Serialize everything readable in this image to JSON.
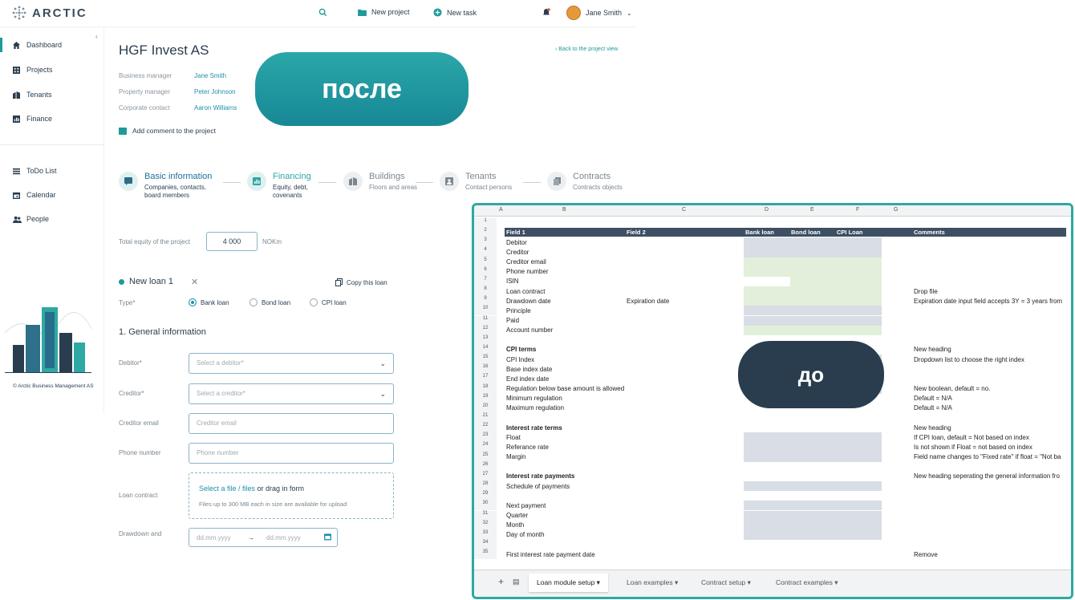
{
  "topbar": {
    "logo": "ARCTIC",
    "new_project": "New project",
    "new_task": "New task",
    "user": "Jane Smith"
  },
  "sidebar": {
    "items": [
      {
        "label": "Dashboard"
      },
      {
        "label": "Projects"
      },
      {
        "label": "Tenants"
      },
      {
        "label": "Finance"
      },
      {
        "label": "ToDo List"
      },
      {
        "label": "Calendar"
      },
      {
        "label": "People"
      }
    ],
    "company": "Arctic Business Management AS"
  },
  "project": {
    "title": "HGF Invest AS",
    "back": "Back to the project view",
    "business_manager_label": "Business manager",
    "business_manager": "Jane Smith",
    "property_manager_label": "Property manager",
    "property_manager": "Peter Johnson",
    "corporate_contact_label": "Corporate contact",
    "corporate_contact": "Aaron Williams",
    "add_comment": "Add comment to the project"
  },
  "steps": [
    {
      "title": "Basic information",
      "sub1": "Companies, contacts,",
      "sub2": "board members"
    },
    {
      "title": "Financing",
      "sub1": "Equity, debt,",
      "sub2": "covenants"
    },
    {
      "title": "Buildings",
      "sub1": "Floors and areas",
      "sub2": ""
    },
    {
      "title": "Tenants",
      "sub1": "Contact persons",
      "sub2": ""
    },
    {
      "title": "Contracts",
      "sub1": "Contracts objects",
      "sub2": ""
    }
  ],
  "equity": {
    "label": "Total equity of the project",
    "value": "4 000",
    "unit": "NOKm"
  },
  "loan": {
    "title": "New loan 1",
    "copy": "Copy this loan",
    "type_label": "Type*",
    "types": [
      "Bank loan",
      "Bond loan",
      "CPI loan"
    ],
    "section": "1. General information",
    "debitor_label": "Debitor*",
    "debitor_ph": "Select a debitor*",
    "creditor_label": "Creditor*",
    "creditor_ph": "Select a creditor*",
    "email_label": "Creditor email",
    "email_ph": "Creditor email",
    "phone_label": "Phone number",
    "phone_ph": "Phone number",
    "contract_label": "Loan contract",
    "upload_link": "Select a file / files",
    "upload_rest": " or drag in form",
    "upload_hint": "Files up to 300 MB each in size are available for upload",
    "drawdown_label": "Drawdown and",
    "date_ph": "dd.mm.yyyy"
  },
  "pills": {
    "after": "после",
    "before": "до"
  },
  "sheet": {
    "columns": [
      "A",
      "B",
      "C",
      "D",
      "E",
      "F",
      "G"
    ],
    "header": {
      "field1": "Field 1",
      "field2": "Field 2",
      "bank": "Bank loan",
      "bond": "Bond loan",
      "cpi": "CPI Loan",
      "comments": "Comments"
    },
    "rows": [
      {
        "n": "1",
        "b": "",
        "c": "",
        "g": ""
      },
      {
        "n": "2",
        "b": "",
        "c": "",
        "g": ""
      },
      {
        "n": "3",
        "b": "Debitor",
        "c": "",
        "g": ""
      },
      {
        "n": "4",
        "b": "Creditor",
        "c": "",
        "g": ""
      },
      {
        "n": "5",
        "b": "Creditor email",
        "c": "",
        "g": ""
      },
      {
        "n": "6",
        "b": "Phone number",
        "c": "",
        "g": ""
      },
      {
        "n": "7",
        "b": "ISIN",
        "c": "",
        "g": ""
      },
      {
        "n": "8",
        "b": "Loan contract",
        "c": "",
        "g": "Drop file"
      },
      {
        "n": "9",
        "b": "Drawdown date",
        "c": "Expiration date",
        "g": "Expiration date input field accepts 3Y = 3 years from"
      },
      {
        "n": "10",
        "b": "Principle",
        "c": "",
        "g": ""
      },
      {
        "n": "11",
        "b": "Paid",
        "c": "",
        "g": ""
      },
      {
        "n": "12",
        "b": "Account number",
        "c": "",
        "g": ""
      },
      {
        "n": "13",
        "b": "",
        "c": "",
        "g": ""
      },
      {
        "n": "14",
        "b": "CPI terms",
        "c": "",
        "g": "New heading"
      },
      {
        "n": "15",
        "b": "CPI Index",
        "c": "",
        "g": "Dropdown list to choose the right index"
      },
      {
        "n": "16",
        "b": "Base index date",
        "c": "",
        "g": ""
      },
      {
        "n": "17",
        "b": "End index date",
        "c": "",
        "g": ""
      },
      {
        "n": "18",
        "b": "Regulation below base amount is allowed",
        "c": "",
        "g": "New boolean, default = no."
      },
      {
        "n": "19",
        "b": "Minimum regulation",
        "c": "",
        "g": "Default = N/A"
      },
      {
        "n": "20",
        "b": "Maximum regulation",
        "c": "",
        "g": "Default = N/A"
      },
      {
        "n": "21",
        "b": "",
        "c": "",
        "g": ""
      },
      {
        "n": "22",
        "b": "Interest rate terms",
        "c": "",
        "g": "New heading"
      },
      {
        "n": "23",
        "b": "Float",
        "c": "",
        "g": "If CPI loan, default = Not based on index"
      },
      {
        "n": "24",
        "b": "Referance rate",
        "c": "",
        "g": "Is not shown if Float = not based on index"
      },
      {
        "n": "25",
        "b": "Margin",
        "c": "",
        "g": "Field name changes to \"Fixed rate\" if float = \"Not ba"
      },
      {
        "n": "26",
        "b": "",
        "c": "",
        "g": ""
      },
      {
        "n": "27",
        "b": "Interest rate payments",
        "c": "",
        "g": "New heading seperating the general information fro"
      },
      {
        "n": "28",
        "b": "Schedule of payments",
        "c": "",
        "g": ""
      },
      {
        "n": "29",
        "b": "",
        "c": "",
        "g": ""
      },
      {
        "n": "30",
        "b": "Next payment",
        "c": "",
        "g": ""
      },
      {
        "n": "31",
        "b": "Quarter",
        "c": "",
        "g": ""
      },
      {
        "n": "32",
        "b": "Month",
        "c": "",
        "g": ""
      },
      {
        "n": "33",
        "b": "Day of month",
        "c": "",
        "g": ""
      },
      {
        "n": "34",
        "b": "",
        "c": "",
        "g": ""
      },
      {
        "n": "35",
        "b": "First interest rate payment date",
        "c": "",
        "g": "Remove"
      }
    ],
    "tabs": [
      "Loan module setup",
      "Loan examples",
      "Contract setup",
      "Contract examples"
    ],
    "colors": {
      "header": "#3d4f63",
      "grey": "#d9dde5",
      "green": "#e2efda",
      "accent": "#2ea8a3"
    }
  }
}
